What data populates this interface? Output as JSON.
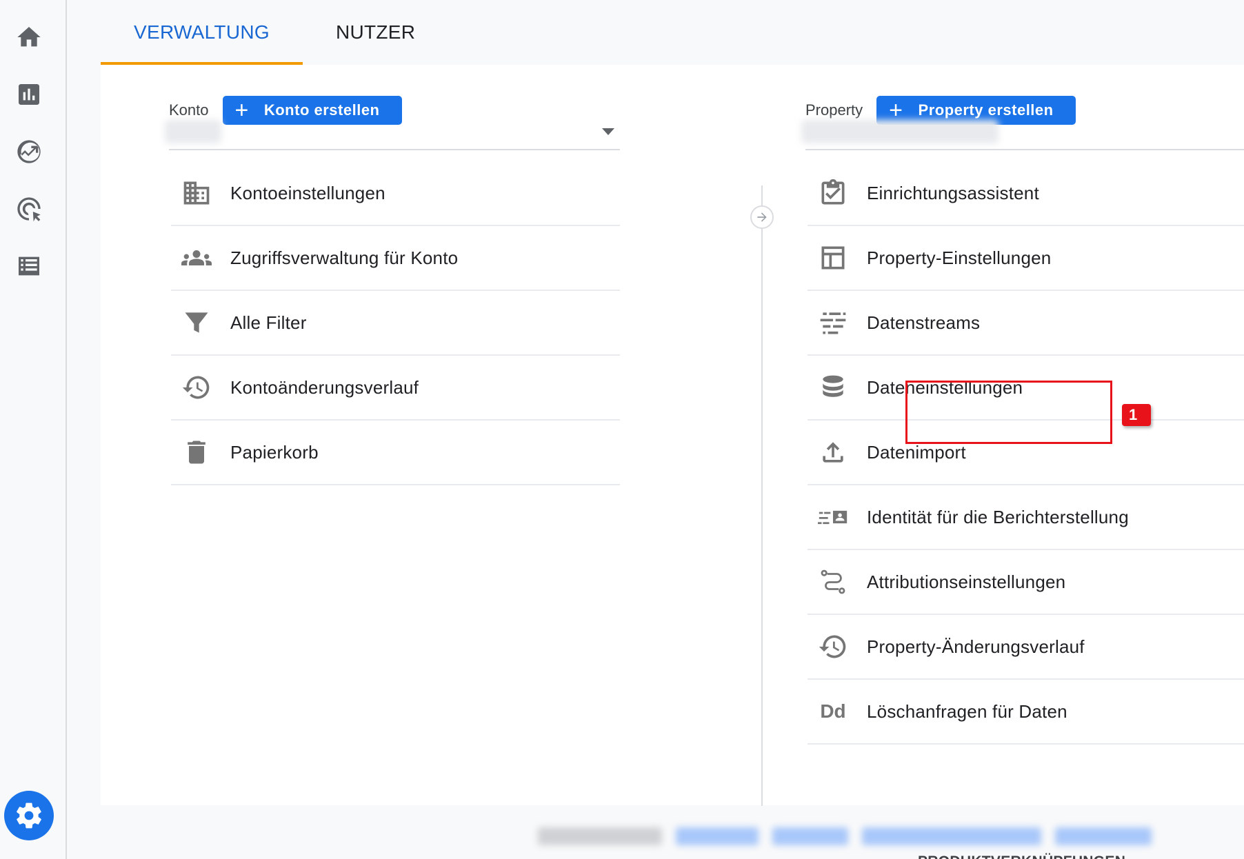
{
  "tabs": {
    "admin": "VERWALTUNG",
    "user": "NUTZER"
  },
  "account": {
    "label": "Konto",
    "create_button": "Konto erstellen",
    "items": [
      {
        "label": "Kontoeinstellungen",
        "icon": "building-icon"
      },
      {
        "label": "Zugriffsverwaltung für Konto",
        "icon": "people-icon"
      },
      {
        "label": "Alle Filter",
        "icon": "filter-icon"
      },
      {
        "label": "Kontoänderungsverlauf",
        "icon": "history-icon"
      },
      {
        "label": "Papierkorb",
        "icon": "trash-icon"
      }
    ]
  },
  "property": {
    "label": "Property",
    "create_button": "Property erstellen",
    "items": [
      {
        "label": "Einrichtungsassistent",
        "icon": "checklist-icon"
      },
      {
        "label": "Property-Einstellungen",
        "icon": "layout-icon"
      },
      {
        "label": "Datenstreams",
        "icon": "streams-icon"
      },
      {
        "label": "Dateneinstellungen",
        "icon": "database-icon"
      },
      {
        "label": "Datenimport",
        "icon": "upload-icon"
      },
      {
        "label": "Identität für die Berichterstellung",
        "icon": "identity-icon"
      },
      {
        "label": "Attributionseinstellungen",
        "icon": "attribution-icon"
      },
      {
        "label": "Property-Änderungsverlauf",
        "icon": "history-icon"
      },
      {
        "label": "Löschanfragen für Daten",
        "icon": "dd-icon",
        "icon_text": "Dd"
      }
    ],
    "section_heading": "PRODUKTVERKNÜPFUNGEN"
  },
  "annotation": {
    "badge": "1"
  },
  "colors": {
    "accent": "#1a73e8",
    "tab_active": "#1967d2",
    "tab_indicator": "#f29900",
    "highlight": "#e8121a"
  }
}
